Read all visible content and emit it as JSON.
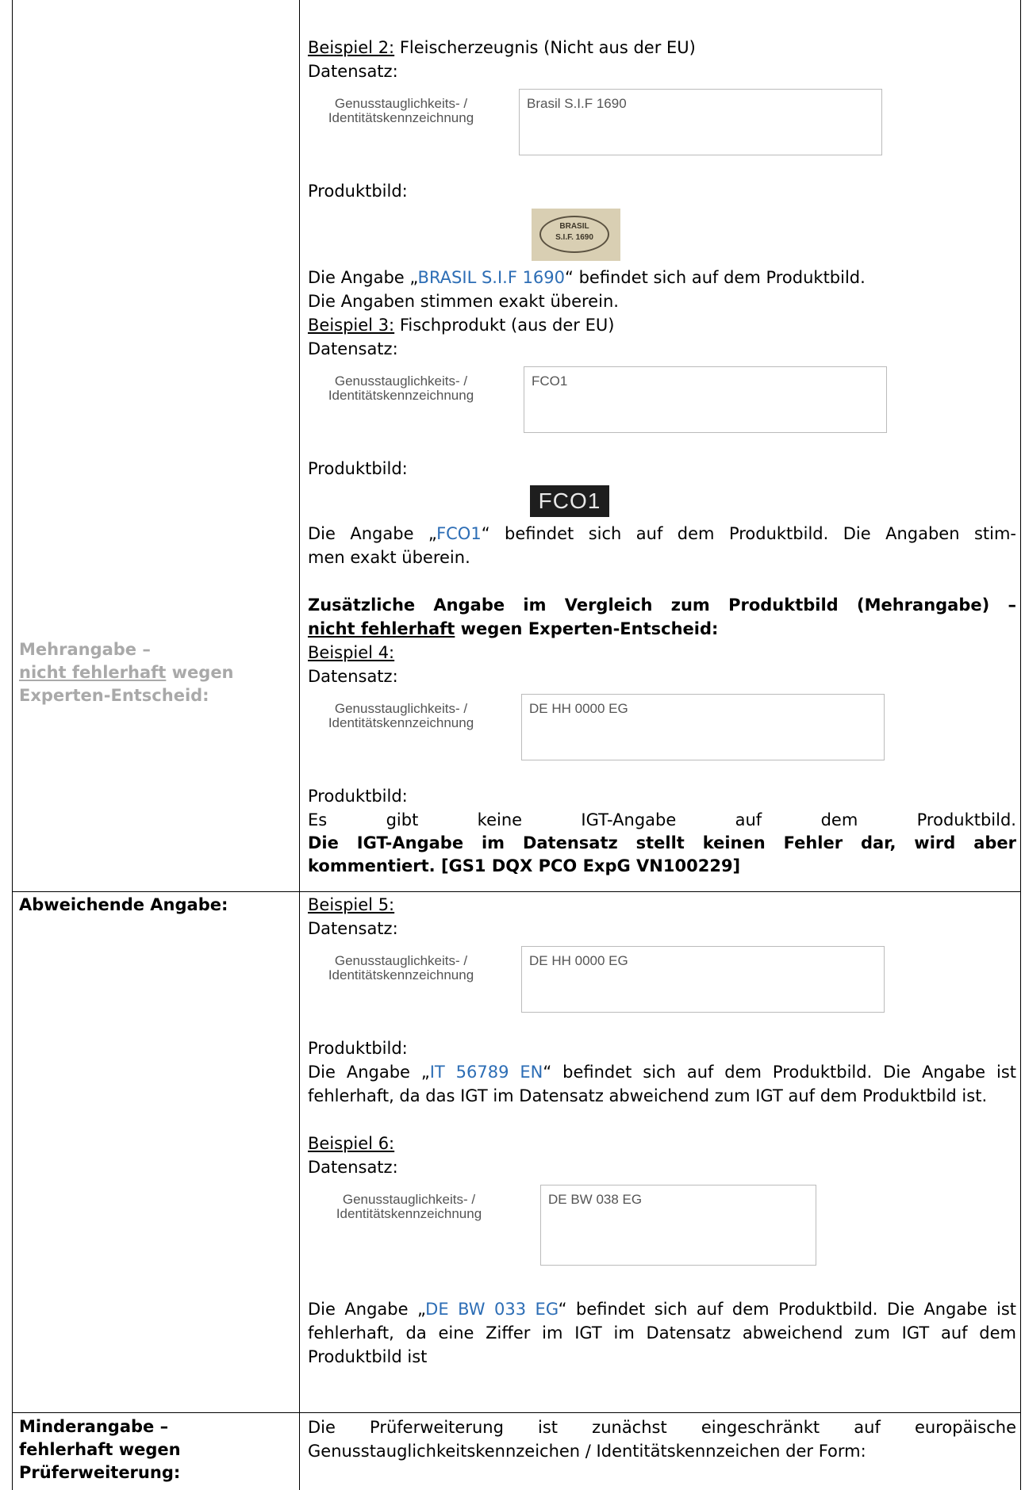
{
  "left_labels": {
    "mehrangabe_line1": "Mehrangabe –",
    "mehrangabe_line2_u": "nicht fehlerhaft",
    "mehrangabe_line2_rest": " wegen",
    "mehrangabe_line3": "Experten-Entscheid:",
    "abweichend": "Abweichende Angabe:",
    "minder_line1": "Minderangabe –",
    "minder_line2": "fehlerhaft wegen",
    "minder_line3": "Prüferweiterung:"
  },
  "field_label_line1": "Genusstauglichkeits- /",
  "field_label_line2": "Identitätskennzeichnung",
  "datensatz": "Datensatz:",
  "produktbild": "Produktbild:",
  "ex2": {
    "title_u": "Beispiel 2:",
    "title_rest": " Fleischerzeugnis (Nicht aus der EU)",
    "value": "Brasil S.I.F 1690",
    "seal_line1": "BRASIL",
    "seal_line2": "S.I.F. 1690",
    "text1": "Die Angabe „",
    "highlight": "BRASIL S.I.F 1690",
    "text2": "“ befindet sich auf dem Produktbild.",
    "text3": "Die Angaben stimmen exakt überein."
  },
  "ex3": {
    "title_u": "Beispiel 3:",
    "title_rest": " Fischprodukt (aus der EU)",
    "value": "FCO1",
    "img_text": "FCO1",
    "text1": "Die Angabe „",
    "highlight": "FCO1",
    "text2": "“ befindet sich auf dem Produktbild. Die Angaben stim-",
    "text3": "men exakt überein."
  },
  "ex4": {
    "heading_line1": "Zusätzliche Angabe im Vergleich zum Produktbild (Mehrangabe) –",
    "heading_u": "nicht fehlerhaft",
    "heading_rest": " wegen Experten-Entscheid:",
    "title_u": "Beispiel 4:",
    "value": "DE HH 0000 EG",
    "text1": "Es gibt keine IGT-Angabe auf dem Produktbild.",
    "bold_text": "Die IGT-Angabe im Datensatz stellt keinen Fehler dar, wird aber kommentiert. [GS1 DQX PCO ExpG VN100229]"
  },
  "ex5": {
    "title_u": "Beispiel 5:",
    "value": "DE HH 0000 EG",
    "text1": "Die Angabe „",
    "highlight": "IT 56789 EN",
    "text2": "“ befindet sich auf dem Produktbild. Die Angabe ist fehlerhaft, da das IGT im Datensatz abweichend zum IGT auf dem Produktbild ist."
  },
  "ex6": {
    "title_u": "Beispiel 6:",
    "value": "DE BW 038 EG",
    "text1": "Die Angabe „",
    "highlight": "DE BW 033 EG",
    "text2": "“ befindet sich auf dem Produktbild. Die Angabe ist fehlerhaft, da eine Ziffer im IGT im Datensatz abweichend zum IGT auf dem Produktbild ist"
  },
  "minder": {
    "text": "Die Prüferweiterung ist zunächst eingeschränkt auf europäische Genusstauglichkeitskennzeichen / Identitätskennzeichen der Form:"
  }
}
